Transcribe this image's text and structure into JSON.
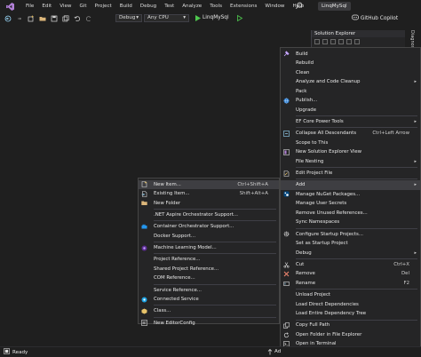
{
  "menubar": {
    "items": [
      "File",
      "Edit",
      "View",
      "Git",
      "Project",
      "Build",
      "Debug",
      "Test",
      "Analyze",
      "Tools",
      "Extensions",
      "Window",
      "Help"
    ],
    "solution_name": "LinqMySql"
  },
  "toolbar": {
    "config": "Debug",
    "platform": "Any CPU",
    "start_target": "LinqMySql",
    "copilot": "GitHub Copilot"
  },
  "solution_explorer": {
    "title": "Solution Explorer",
    "side_tab": "Diagnostic"
  },
  "context_menu": {
    "items": [
      {
        "label": "Build",
        "icon": "build-icon"
      },
      {
        "label": "Rebuild",
        "icon": ""
      },
      {
        "label": "Clean",
        "icon": ""
      },
      {
        "label": "Analyze and Code Cleanup",
        "icon": "",
        "submenu": true
      },
      {
        "label": "Pack",
        "icon": ""
      },
      {
        "label": "Publish...",
        "icon": "globe-icon"
      },
      {
        "label": "Upgrade",
        "icon": ""
      },
      {
        "sep": true
      },
      {
        "label": "EF Core Power Tools",
        "icon": "",
        "submenu": true
      },
      {
        "sep": true
      },
      {
        "label": "Collapse All Descendants",
        "icon": "collapse-icon",
        "shortcut": "Ctrl+Left Arrow"
      },
      {
        "label": "Scope to This",
        "icon": ""
      },
      {
        "label": "New Solution Explorer View",
        "icon": "solution-view-icon"
      },
      {
        "label": "File Nesting",
        "icon": "",
        "submenu": true
      },
      {
        "sep": true
      },
      {
        "label": "Edit Project File",
        "icon": "edit-file-icon"
      },
      {
        "sep": true
      },
      {
        "label": "Add",
        "icon": "",
        "submenu": true,
        "highlight": true
      },
      {
        "label": "Manage NuGet Packages...",
        "icon": "nuget-icon"
      },
      {
        "label": "Manage User Secrets",
        "icon": ""
      },
      {
        "label": "Remove Unused References...",
        "icon": ""
      },
      {
        "label": "Sync Namespaces",
        "icon": ""
      },
      {
        "sep": true
      },
      {
        "label": "Configure Startup Projects...",
        "icon": "gear-icon"
      },
      {
        "label": "Set as Startup Project",
        "icon": ""
      },
      {
        "label": "Debug",
        "icon": "",
        "submenu": true
      },
      {
        "sep": true
      },
      {
        "label": "Cut",
        "icon": "scissors-icon",
        "shortcut": "Ctrl+X"
      },
      {
        "label": "Remove",
        "icon": "close-icon",
        "shortcut": "Del"
      },
      {
        "label": "Rename",
        "icon": "rename-icon",
        "shortcut": "F2"
      },
      {
        "sep": true
      },
      {
        "label": "Unload Project",
        "icon": ""
      },
      {
        "label": "Load Direct Dependencies",
        "icon": ""
      },
      {
        "label": "Load Entire Dependency Tree",
        "icon": ""
      },
      {
        "sep": true
      },
      {
        "label": "Copy Full Path",
        "icon": "copy-icon"
      },
      {
        "label": "Open Folder in File Explorer",
        "icon": "refresh-icon"
      },
      {
        "label": "Open in Terminal",
        "icon": "terminal-icon"
      },
      {
        "sep": true
      },
      {
        "label": "Properties",
        "icon": "wrench-icon",
        "shortcut": "Alt+Enter"
      }
    ]
  },
  "add_submenu": {
    "items": [
      {
        "label": "New Item...",
        "icon": "new-item-icon",
        "shortcut": "Ctrl+Shift+A",
        "highlight": true
      },
      {
        "label": "Existing Item...",
        "icon": "existing-item-icon",
        "shortcut": "Shift+Alt+A"
      },
      {
        "label": "New Folder",
        "icon": "folder-icon"
      },
      {
        "sep": true
      },
      {
        "label": ".NET Aspire Orchestrator Support...",
        "icon": ""
      },
      {
        "sep": true
      },
      {
        "label": "Container Orchestrator Support...",
        "icon": "container-icon"
      },
      {
        "label": "Docker Support...",
        "icon": ""
      },
      {
        "sep": true
      },
      {
        "label": "Machine Learning Model...",
        "icon": "ml-icon"
      },
      {
        "sep": true
      },
      {
        "label": "Project Reference...",
        "icon": ""
      },
      {
        "label": "Shared Project Reference...",
        "icon": ""
      },
      {
        "label": "COM Reference...",
        "icon": ""
      },
      {
        "sep": true
      },
      {
        "label": "Service Reference...",
        "icon": ""
      },
      {
        "label": "Connected Service",
        "icon": "connected-service-icon"
      },
      {
        "sep": true
      },
      {
        "label": "Class...",
        "icon": "class-icon"
      },
      {
        "sep": true
      },
      {
        "label": "New EditorConfig",
        "icon": "editorconfig-icon"
      }
    ]
  },
  "status": {
    "text": "Ready",
    "right_text": "Ad"
  },
  "colors": {
    "background": "#1f1f1f",
    "menu": "#252526",
    "highlight": "#3e3e42",
    "accent": "#68217a",
    "play_green": "#4ec84e"
  }
}
